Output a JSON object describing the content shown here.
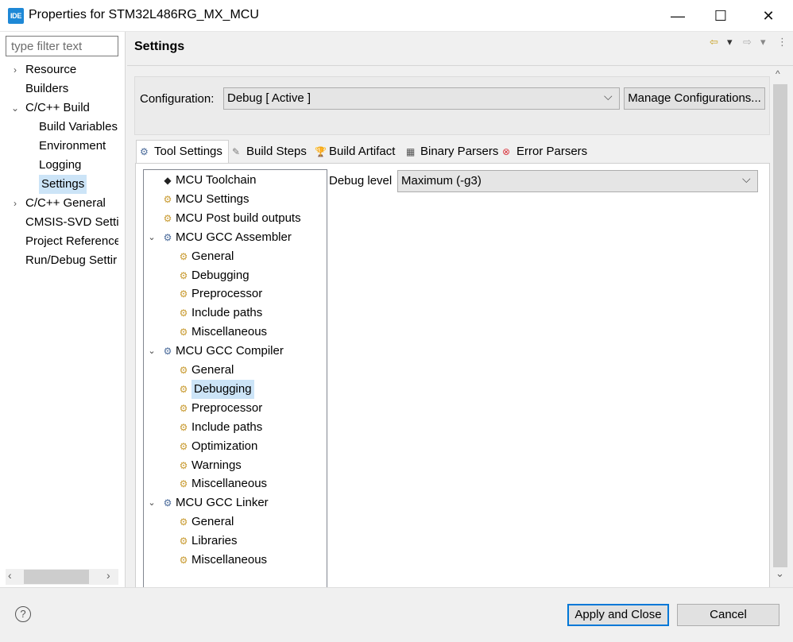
{
  "window": {
    "app_badge": "IDE",
    "title": "Properties for STM32L486RG_MX_MCU",
    "minimize": "—",
    "maximize": "☐",
    "close": "✕"
  },
  "nav": {
    "filter_placeholder": "type filter text",
    "items": [
      {
        "label": "Resource",
        "level": 0,
        "expander": "›"
      },
      {
        "label": "Builders",
        "level": 0,
        "expander": ""
      },
      {
        "label": "C/C++ Build",
        "level": 0,
        "expander": "⌄"
      },
      {
        "label": "Build Variables",
        "level": 1,
        "expander": ""
      },
      {
        "label": "Environment",
        "level": 1,
        "expander": ""
      },
      {
        "label": "Logging",
        "level": 1,
        "expander": ""
      },
      {
        "label": "Settings",
        "level": 1,
        "expander": "",
        "selected": true
      },
      {
        "label": "C/C++ General",
        "level": 0,
        "expander": "›"
      },
      {
        "label": "CMSIS-SVD Setti",
        "level": 0,
        "expander": ""
      },
      {
        "label": "Project Reference:",
        "level": 0,
        "expander": ""
      },
      {
        "label": "Run/Debug Settir",
        "level": 0,
        "expander": ""
      }
    ],
    "scroll_left": "‹",
    "scroll_right": "›"
  },
  "page": {
    "title": "Settings",
    "back_icon": "⇦",
    "dropdown_icon": "▾",
    "forward_icon": "⇨",
    "menu_icon": "⋮"
  },
  "config": {
    "label": "Configuration:",
    "value": "Debug  [ Active ]",
    "manage_label": "Manage Configurations..."
  },
  "tabs": [
    {
      "label": "Tool Settings",
      "icon": "⚙",
      "active": true
    },
    {
      "label": "Build Steps",
      "icon": "✎",
      "active": false
    },
    {
      "label": "Build Artifact",
      "icon": "🏆",
      "active": false
    },
    {
      "label": "Binary Parsers",
      "icon": "▦",
      "active": false
    },
    {
      "label": "Error Parsers",
      "icon": "⊗",
      "active": false
    }
  ],
  "tree": [
    {
      "label": "MCU Toolchain",
      "level": 0,
      "expander": "",
      "icon": "◆"
    },
    {
      "label": "MCU Settings",
      "level": 0,
      "expander": "",
      "icon": "⚙"
    },
    {
      "label": "MCU Post build outputs",
      "level": 0,
      "expander": "",
      "icon": "⚙"
    },
    {
      "label": "MCU GCC Assembler",
      "level": 0,
      "expander": "⌄",
      "icon": "⚙"
    },
    {
      "label": "General",
      "level": 1,
      "expander": "",
      "icon": "⚙"
    },
    {
      "label": "Debugging",
      "level": 1,
      "expander": "",
      "icon": "⚙"
    },
    {
      "label": "Preprocessor",
      "level": 1,
      "expander": "",
      "icon": "⚙"
    },
    {
      "label": "Include paths",
      "level": 1,
      "expander": "",
      "icon": "⚙"
    },
    {
      "label": "Miscellaneous",
      "level": 1,
      "expander": "",
      "icon": "⚙"
    },
    {
      "label": "MCU GCC Compiler",
      "level": 0,
      "expander": "⌄",
      "icon": "⚙"
    },
    {
      "label": "General",
      "level": 1,
      "expander": "",
      "icon": "⚙"
    },
    {
      "label": "Debugging",
      "level": 1,
      "expander": "",
      "icon": "⚙",
      "selected": true
    },
    {
      "label": "Preprocessor",
      "level": 1,
      "expander": "",
      "icon": "⚙"
    },
    {
      "label": "Include paths",
      "level": 1,
      "expander": "",
      "icon": "⚙"
    },
    {
      "label": "Optimization",
      "level": 1,
      "expander": "",
      "icon": "⚙"
    },
    {
      "label": "Warnings",
      "level": 1,
      "expander": "",
      "icon": "⚙"
    },
    {
      "label": "Miscellaneous",
      "level": 1,
      "expander": "",
      "icon": "⚙"
    },
    {
      "label": "MCU GCC Linker",
      "level": 0,
      "expander": "⌄",
      "icon": "⚙"
    },
    {
      "label": "General",
      "level": 1,
      "expander": "",
      "icon": "⚙"
    },
    {
      "label": "Libraries",
      "level": 1,
      "expander": "",
      "icon": "⚙"
    },
    {
      "label": "Miscellaneous",
      "level": 1,
      "expander": "",
      "icon": "⚙"
    }
  ],
  "debug": {
    "label": "Debug level",
    "value": "Maximum (-g3)"
  },
  "footer": {
    "help_icon": "?",
    "apply_label": "Apply and Close",
    "cancel_label": "Cancel"
  },
  "scroll": {
    "up": "^",
    "down": "⌄"
  },
  "colors": {
    "selection": "#cce4f7",
    "accent": "#0078d7",
    "app_icon": "#1e88d6"
  }
}
